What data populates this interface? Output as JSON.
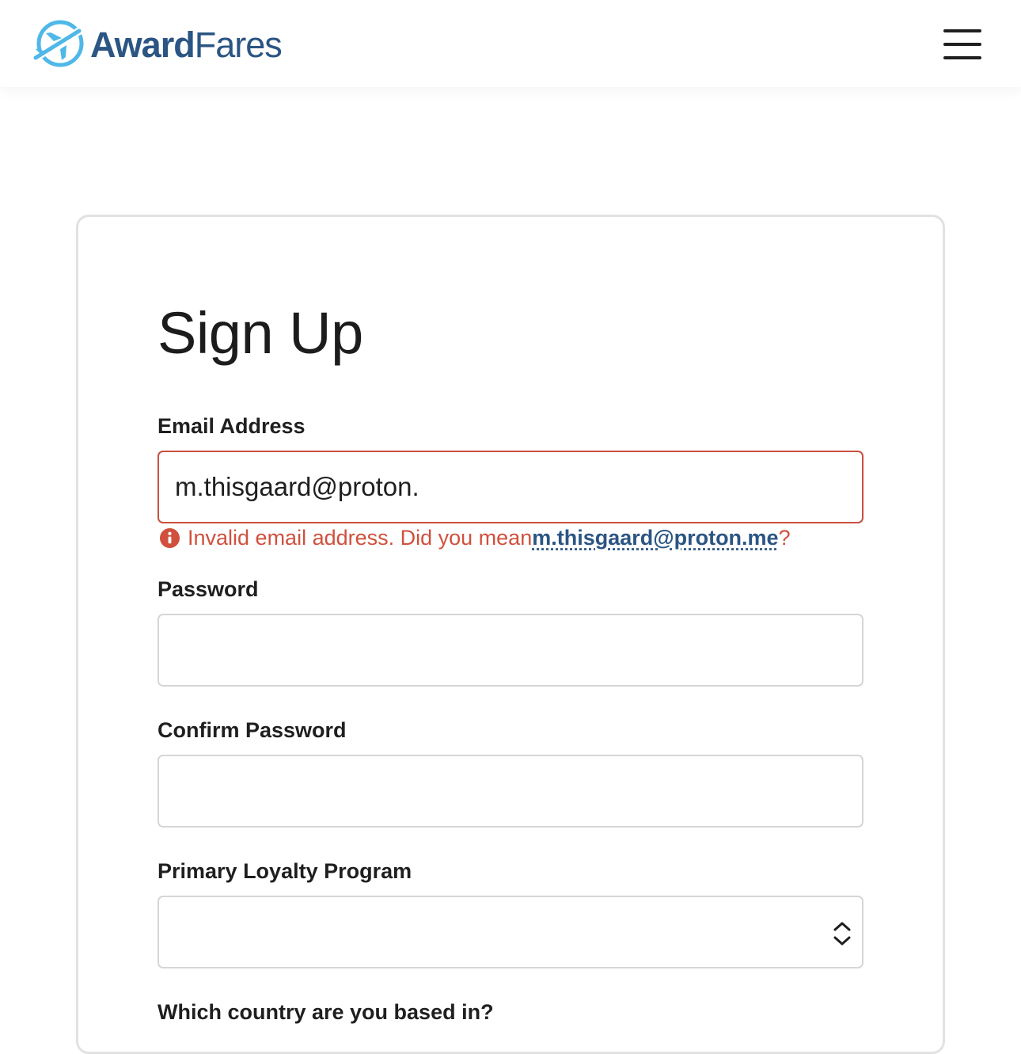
{
  "header": {
    "logo_bold": "Award",
    "logo_light": "Fares",
    "logo_icon": "airplane-circle-icon",
    "menu_icon": "hamburger-menu-icon"
  },
  "form": {
    "title": "Sign Up",
    "email": {
      "label": "Email Address",
      "value": "m.thisgaard@proton.",
      "error_prefix": "Invalid email address. Did you mean ",
      "suggestion": "m.thisgaard@proton.me",
      "error_suffix": "?"
    },
    "password": {
      "label": "Password",
      "value": ""
    },
    "confirm_password": {
      "label": "Confirm Password",
      "value": ""
    },
    "loyalty_program": {
      "label": "Primary Loyalty Program",
      "selected": ""
    },
    "country": {
      "label": "Which country are you based in?"
    }
  },
  "colors": {
    "brand_blue": "#2b5583",
    "logo_light_blue": "#4fb8e8",
    "error_red": "#c9503f",
    "border_gray": "#d6d6d6"
  }
}
